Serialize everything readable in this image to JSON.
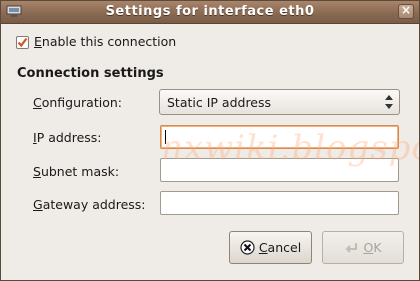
{
  "window": {
    "title": "Settings for interface eth0"
  },
  "enable": {
    "label_pre": "",
    "label_ul": "E",
    "label_post": "nable this connection",
    "checked": true
  },
  "section": {
    "title": "Connection settings"
  },
  "configuration": {
    "label_ul": "C",
    "label_rest": "onfiguration:",
    "value": "Static IP address"
  },
  "ip": {
    "label_ul": "I",
    "label_rest": "P address:",
    "value": ""
  },
  "subnet": {
    "label_ul": "S",
    "label_rest": "ubnet mask:",
    "value": ""
  },
  "gateway": {
    "label_ul": "G",
    "label_rest": "ateway address:",
    "value": ""
  },
  "watermark": "nxwiki.blogspot.com",
  "buttons": {
    "cancel": {
      "ul": "C",
      "rest": "ancel",
      "enabled": true
    },
    "ok": {
      "ul": "O",
      "rest": "K",
      "enabled": false
    }
  },
  "colors": {
    "titlebar": "#8a6a52",
    "focus": "#d88a4e",
    "check": "#d0562a",
    "cancel_icon": "#b02020"
  }
}
